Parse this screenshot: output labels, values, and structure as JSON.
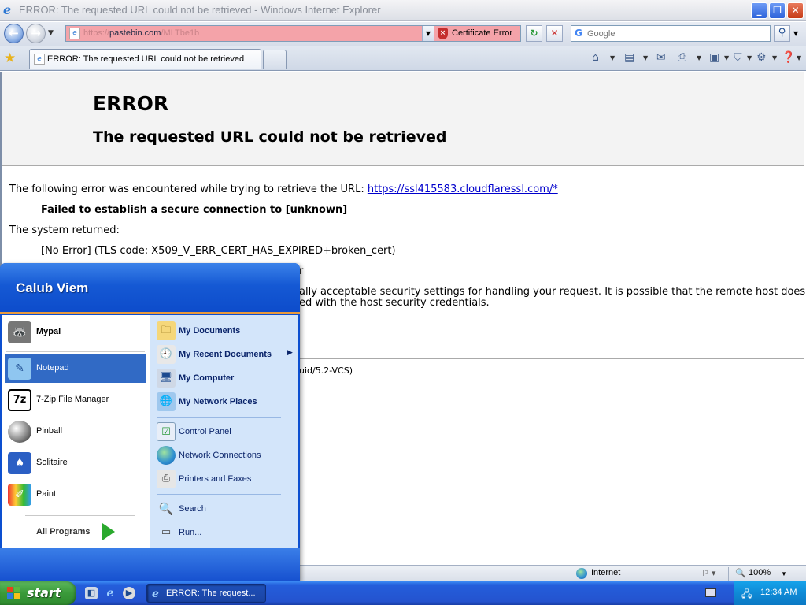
{
  "window": {
    "title": "ERROR: The requested URL could not be retrieved - Windows Internet Explorer"
  },
  "address_bar": {
    "url_prefix": "https://",
    "url_host": "pastebin.com",
    "url_path": "/MLTbe1b",
    "cert_error": "Certificate Error",
    "search_placeholder": "Google"
  },
  "tab": {
    "label": "ERROR: The requested URL could not be retrieved"
  },
  "page": {
    "title": "ERROR",
    "subtitle": "The requested URL could not be retrieved",
    "intro": "The following error was encountered while trying to retrieve the URL: ",
    "link": "https://ssl415583.cloudflaressl.com/*",
    "failed": "Failed to establish a secure connection to [unknown]",
    "system_returned": "The system returned:",
    "tls_error": "[No Error] (TLS code: X509_V_ERR_CERT_HAS_EXPIRED+broken_cert)",
    "line_partial_r": "r",
    "security_line1": "ally acceptable security settings for handling your request. It is possible that the remote host does",
    "security_line2": "ed with the host security credentials.",
    "footer_partial": "uid/5.2-VCS)"
  },
  "status_bar": {
    "zone": "Internet",
    "zoom": "100%"
  },
  "start_menu": {
    "user": "Calub Viem",
    "pinned": [
      {
        "label": "Mypal",
        "icon": "raccoon-icon"
      }
    ],
    "recent": [
      {
        "label": "Notepad",
        "icon": "notepad-icon"
      },
      {
        "label": "7-Zip File Manager",
        "icon": "7zip-icon"
      },
      {
        "label": "Pinball",
        "icon": "pinball-icon"
      },
      {
        "label": "Solitaire",
        "icon": "solitaire-icon"
      },
      {
        "label": "Paint",
        "icon": "paint-icon"
      }
    ],
    "all_programs": "All Programs",
    "right_primary": [
      {
        "label": "My Documents",
        "icon": "folder-icon"
      },
      {
        "label": "My Recent Documents",
        "icon": "recent-docs-icon"
      },
      {
        "label": "My Computer",
        "icon": "computer-icon"
      },
      {
        "label": "My Network Places",
        "icon": "network-icon"
      }
    ],
    "right_secondary": [
      {
        "label": "Control Panel",
        "icon": "control-panel-icon"
      },
      {
        "label": "Network Connections",
        "icon": "network-connections-icon"
      },
      {
        "label": "Printers and Faxes",
        "icon": "printer-icon"
      }
    ],
    "right_tertiary": [
      {
        "label": "Search",
        "icon": "search-icon"
      },
      {
        "label": "Run...",
        "icon": "run-icon"
      }
    ]
  },
  "taskbar": {
    "start_label": "start",
    "task_label": "ERROR: The request...",
    "clock": "12:34 AM"
  },
  "colors": {
    "address_error_bg": "#f4a3a9",
    "start_menu_blue": "#0c4fd0",
    "highlight": "#316ac5",
    "start_green": "#3a9a3a"
  }
}
